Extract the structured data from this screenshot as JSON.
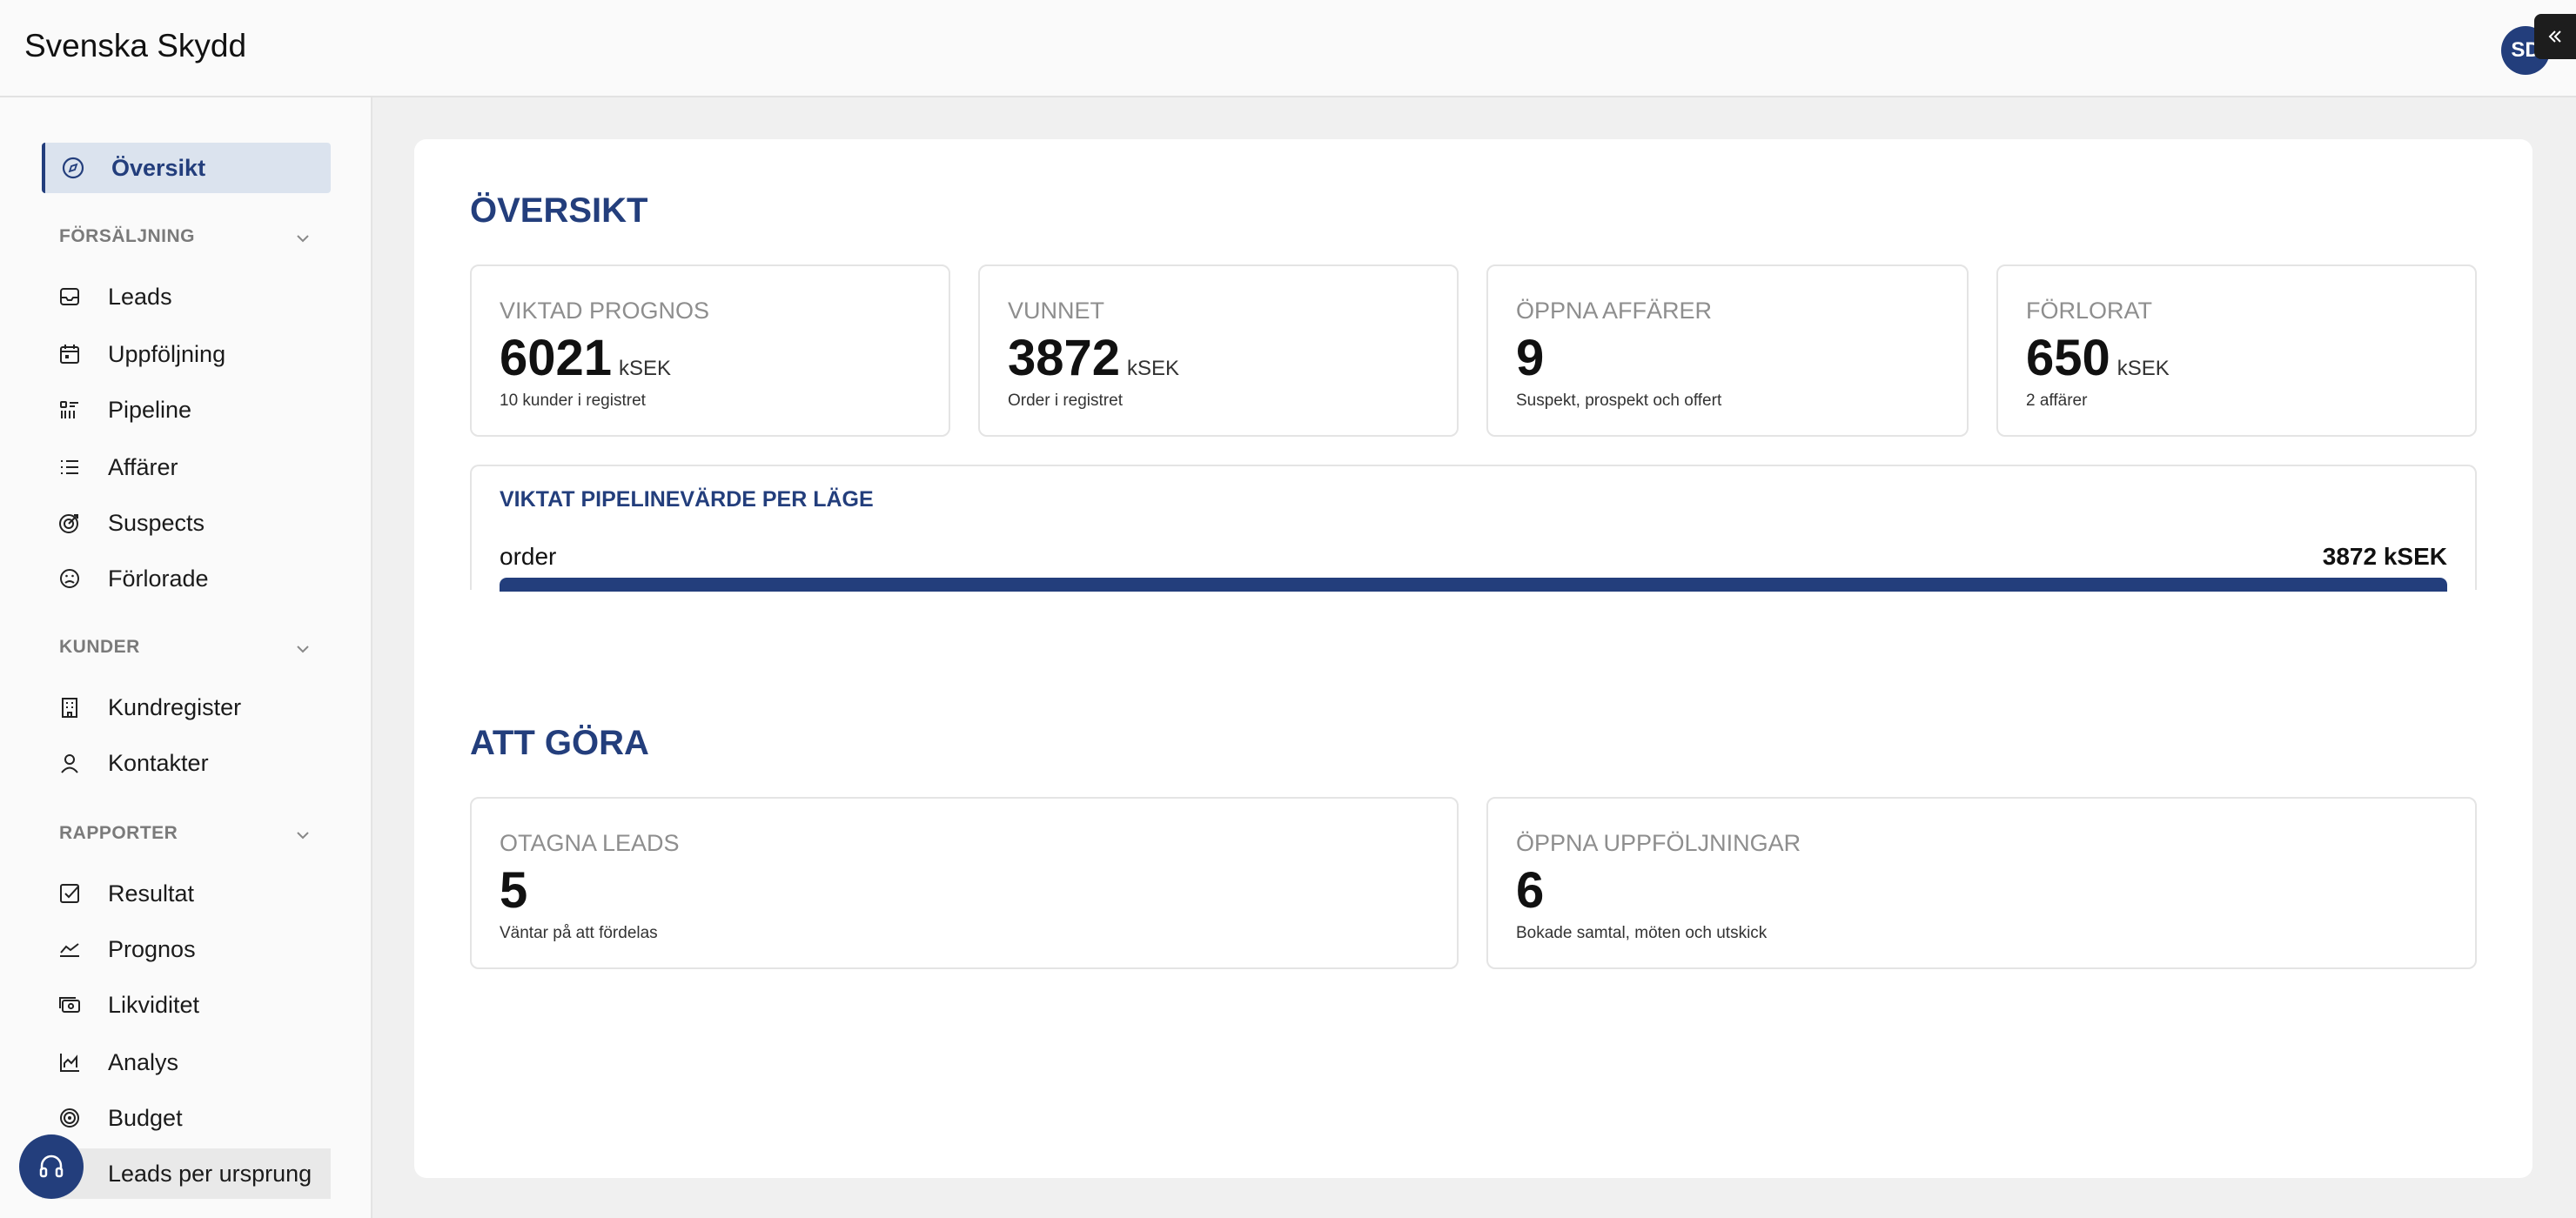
{
  "app": {
    "title": "Svenska Skydd",
    "avatar_initials": "SD"
  },
  "colors": {
    "accent": "#233e7c",
    "active_bg": "#dbe3ee"
  },
  "sidebar": {
    "top_item": {
      "label": "Översikt",
      "icon": "compass-icon",
      "active": true
    },
    "sections": [
      {
        "heading": "FÖRSÄLJNING",
        "items": [
          {
            "label": "Leads",
            "icon": "inbox-icon"
          },
          {
            "label": "Uppföljning",
            "icon": "calendar-icon"
          },
          {
            "label": "Pipeline",
            "icon": "pipeline-icon"
          },
          {
            "label": "Affärer",
            "icon": "list-icon"
          },
          {
            "label": "Suspects",
            "icon": "target-icon"
          },
          {
            "label": "Förlorade",
            "icon": "sad-face-icon"
          }
        ]
      },
      {
        "heading": "KUNDER",
        "items": [
          {
            "label": "Kundregister",
            "icon": "building-icon"
          },
          {
            "label": "Kontakter",
            "icon": "user-icon"
          }
        ]
      },
      {
        "heading": "RAPPORTER",
        "items": [
          {
            "label": "Resultat",
            "icon": "check-square-icon"
          },
          {
            "label": "Prognos",
            "icon": "trend-line-icon"
          },
          {
            "label": "Likviditet",
            "icon": "cash-icon"
          },
          {
            "label": "Analys",
            "icon": "area-chart-icon"
          },
          {
            "label": "Budget",
            "icon": "bullseye-icon"
          },
          {
            "label": "Leads per ursprung",
            "icon": "pie-icon"
          }
        ]
      }
    ]
  },
  "overview": {
    "title": "ÖVERSIKT",
    "kpis": [
      {
        "label": "VIKTAD PROGNOS",
        "value": "6021",
        "unit": "kSEK",
        "sub": "10 kunder i registret"
      },
      {
        "label": "VUNNET",
        "value": "3872",
        "unit": "kSEK",
        "sub": "Order i registret"
      },
      {
        "label": "ÖPPNA AFFÄRER",
        "value": "9",
        "unit": "",
        "sub": "Suspekt, prospekt och offert"
      },
      {
        "label": "FÖRLORAT",
        "value": "650",
        "unit": "kSEK",
        "sub": "2 affärer"
      }
    ],
    "pipeline": {
      "title": "VIKTAT PIPELINEVÄRDE PER LÄGE",
      "rows": [
        {
          "label": "order",
          "value_text": "3872 kSEK",
          "fraction": 1.0
        }
      ]
    }
  },
  "todo": {
    "title": "ATT GÖRA",
    "cards": [
      {
        "label": "OTAGNA LEADS",
        "value": "5",
        "sub": "Väntar på att fördelas"
      },
      {
        "label": "ÖPPNA UPPFÖLJNINGAR",
        "value": "6",
        "sub": "Bokade samtal, möten och utskick"
      }
    ]
  }
}
